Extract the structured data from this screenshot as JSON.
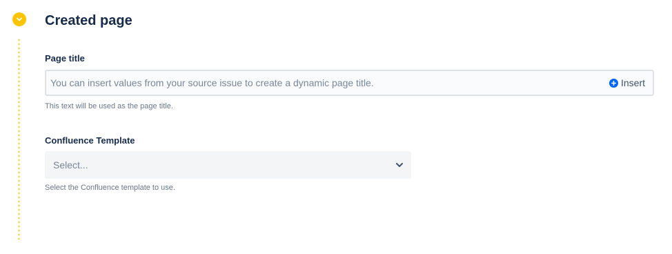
{
  "section": {
    "title": "Created page",
    "marker_icon": "chevron-down-icon",
    "accent_color": "#ffc400"
  },
  "page_title_field": {
    "label": "Page title",
    "placeholder": "You can insert values from your source issue to create a dynamic page title.",
    "value": "",
    "insert_label": "Insert",
    "insert_icon": "plus-circle-icon",
    "helper": "This text will be used as the page title."
  },
  "template_field": {
    "label": "Confluence Template",
    "selected": "Select...",
    "dropdown_icon": "chevron-down-icon",
    "helper": "Select the Confluence template to use."
  }
}
